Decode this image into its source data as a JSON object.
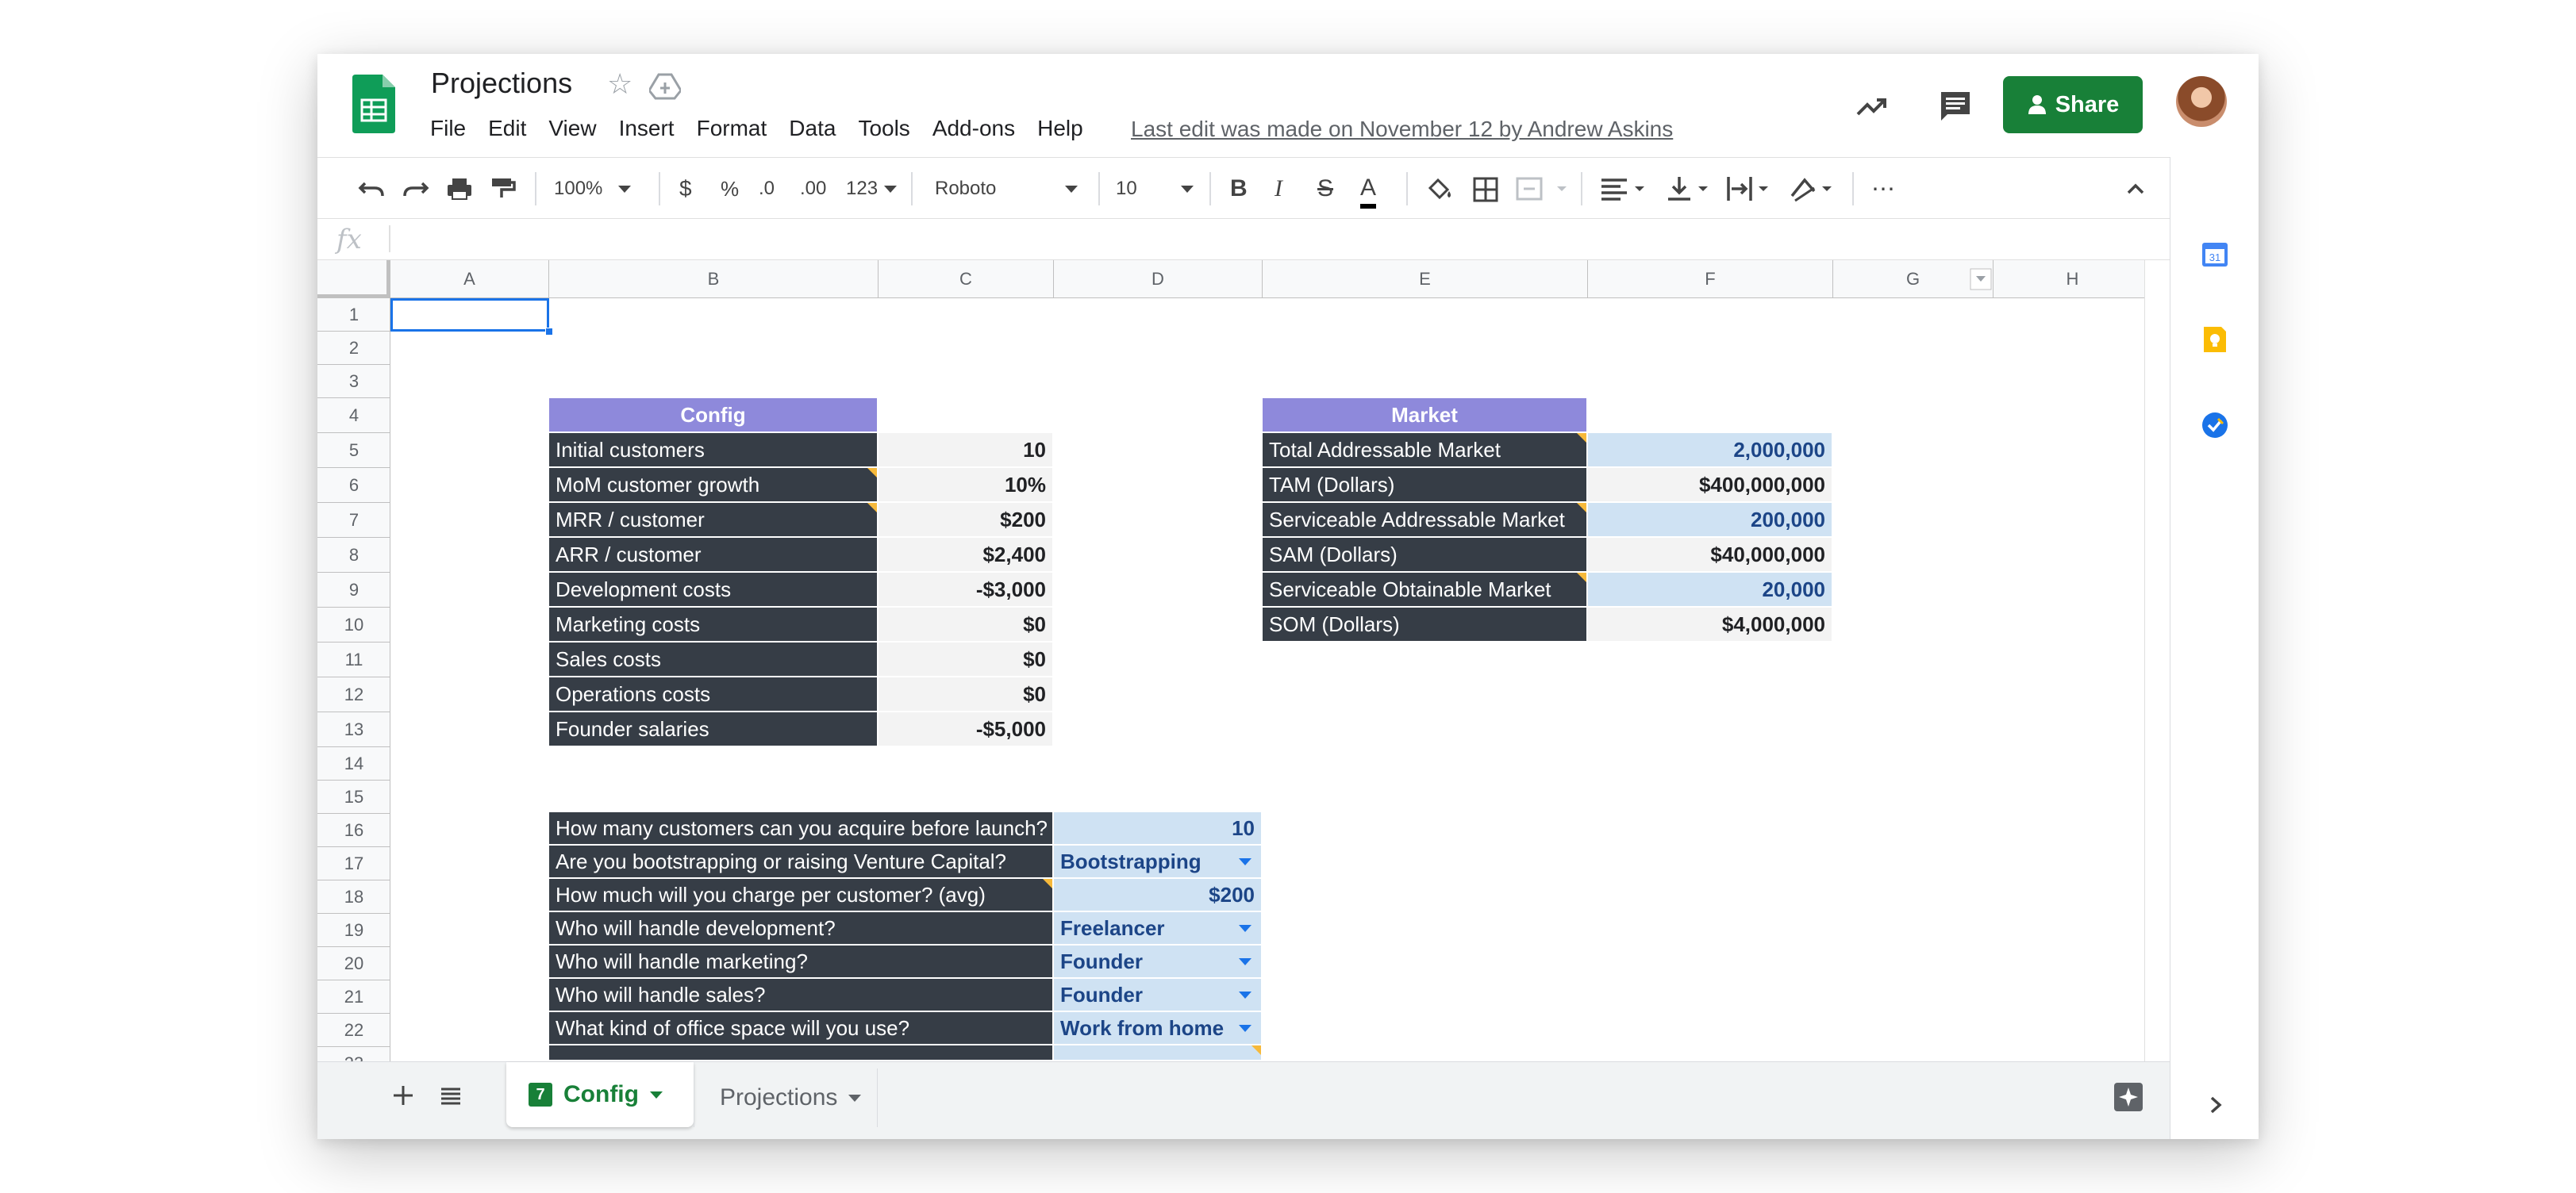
{
  "doc": {
    "title": "Projections",
    "last_edit": "Last edit was made on November 12 by Andrew Askins"
  },
  "menu": [
    "File",
    "Edit",
    "View",
    "Insert",
    "Format",
    "Data",
    "Tools",
    "Add-ons",
    "Help"
  ],
  "share_label": "Share",
  "toolbar": {
    "zoom": "100%",
    "currency": "$",
    "percent": "%",
    "dec_less": ".0",
    "dec_more": ".00",
    "more_formats": "123",
    "font": "Roboto",
    "size": "10",
    "bold": "B",
    "italic": "I",
    "strike": "S",
    "text_color": "A"
  },
  "formula": {
    "fx": "fx"
  },
  "columns": [
    "A",
    "B",
    "C",
    "D",
    "E",
    "F",
    "G",
    "H"
  ],
  "rows": [
    "1",
    "2",
    "3",
    "4",
    "5",
    "6",
    "7",
    "8",
    "9",
    "10",
    "11",
    "12",
    "13",
    "14",
    "15",
    "16",
    "17",
    "18",
    "19",
    "20",
    "21",
    "22",
    "23"
  ],
  "config": {
    "header": "Config",
    "items": [
      {
        "label": "Initial customers",
        "value": "10"
      },
      {
        "label": "MoM customer growth",
        "value": "10%"
      },
      {
        "label": "MRR / customer",
        "value": "$200"
      },
      {
        "label": "ARR / customer",
        "value": "$2,400"
      },
      {
        "label": "Development costs",
        "value": "-$3,000"
      },
      {
        "label": "Marketing costs",
        "value": "$0"
      },
      {
        "label": "Sales costs",
        "value": "$0"
      },
      {
        "label": "Operations costs",
        "value": "$0"
      },
      {
        "label": "Founder salaries",
        "value": "-$5,000"
      }
    ]
  },
  "market": {
    "header": "Market",
    "items": [
      {
        "label": "Total Addressable Market",
        "value": "2,000,000"
      },
      {
        "label": "TAM (Dollars)",
        "value": "$400,000,000"
      },
      {
        "label": "Serviceable Addressable Market",
        "value": "200,000"
      },
      {
        "label": "SAM (Dollars)",
        "value": "$40,000,000"
      },
      {
        "label": "Serviceable Obtainable Market",
        "value": "20,000"
      },
      {
        "label": "SOM (Dollars)",
        "value": "$4,000,000"
      }
    ]
  },
  "questions": [
    {
      "q": "How many customers can you acquire before launch?",
      "a": "10"
    },
    {
      "q": "Are you bootstrapping or raising Venture Capital?",
      "a": "Bootstrapping"
    },
    {
      "q": "How much will you charge per customer? (avg)",
      "a": "$200"
    },
    {
      "q": "Who will handle development?",
      "a": "Freelancer"
    },
    {
      "q": "Who will handle marketing?",
      "a": "Founder"
    },
    {
      "q": "Who will handle sales?",
      "a": "Founder"
    },
    {
      "q": "What kind of office space will you use?",
      "a": "Work from home"
    }
  ],
  "sheets": [
    {
      "name": "Config",
      "badge": "7"
    },
    {
      "name": "Projections"
    }
  ],
  "colors": {
    "share": "#188038",
    "header_fill": "#8e89db",
    "label_fill": "#363d46",
    "input_fill": "#cfe2f3",
    "value_fill": "#f3f3f3"
  }
}
